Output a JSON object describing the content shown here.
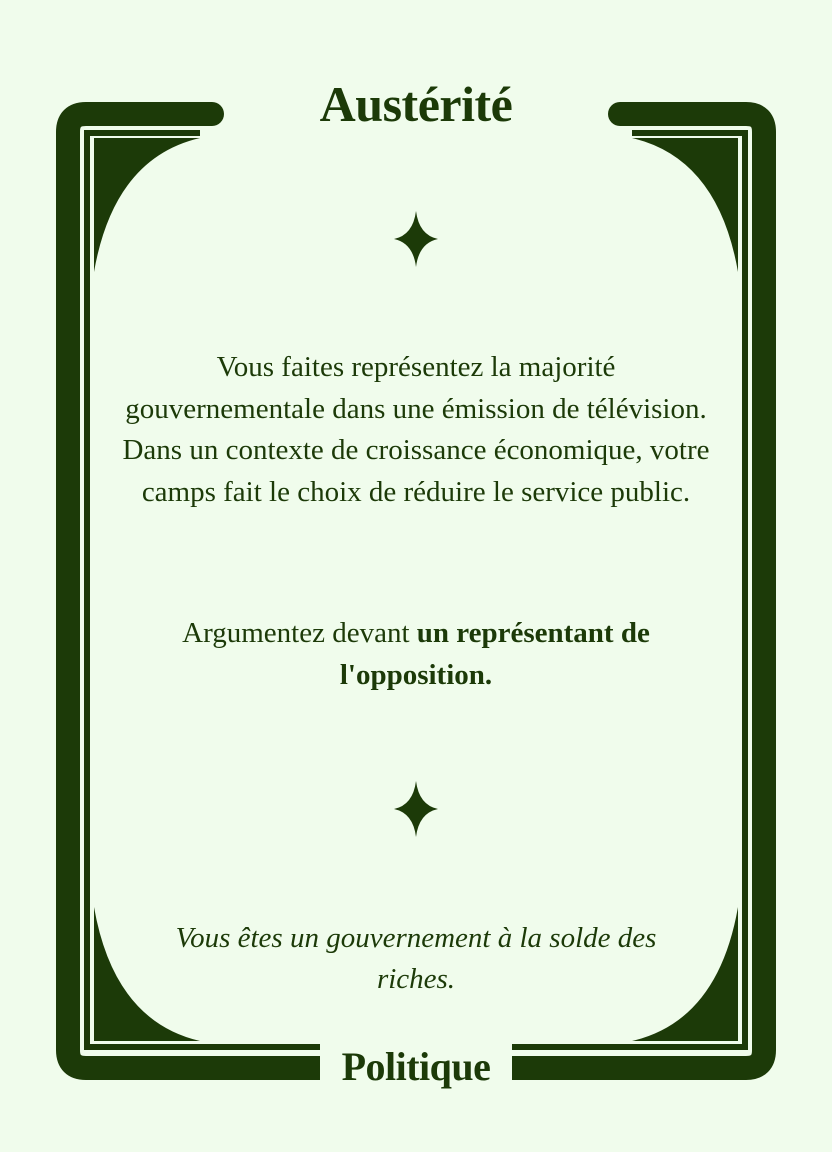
{
  "card": {
    "title": "Austérité",
    "category": "Politique",
    "scenario": "Vous faites représentez la majorité gouvernementale dans une émission de télévision. Dans un contexte de croissance économique, votre camps fait le choix de réduire le service public.",
    "instruction": {
      "prefix": "Argumentez devant ",
      "target": "un représentant de l'opposition."
    },
    "role": "Vous êtes un gouvernement à la solde des riches."
  },
  "theme": {
    "primary_color": "#1c3a08",
    "background_color": "#f0fcec"
  },
  "icons": {
    "divider": "four-point-sparkle-icon"
  }
}
